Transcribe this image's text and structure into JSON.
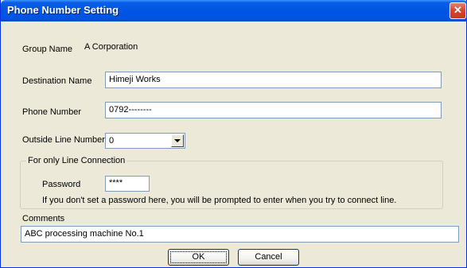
{
  "window": {
    "title": "Phone Number Setting",
    "close_glyph": "✕"
  },
  "group": {
    "label": "Group Name",
    "value": "A Corporation"
  },
  "destination": {
    "label": "Destination Name",
    "value": "Himeji Works"
  },
  "phone": {
    "label": "Phone Number",
    "value": "0792--------"
  },
  "outside_line": {
    "label": "Outside Line Number",
    "value": "0"
  },
  "line_connection": {
    "legend": "For only Line Connection",
    "password_label": "Password",
    "password_value": "****",
    "note": "If you don't set a password here, you will be prompted to enter when you try to connect line."
  },
  "comments": {
    "label": "Comments",
    "value": "ABC processing machine No.1"
  },
  "buttons": {
    "ok": "OK",
    "cancel": "Cancel"
  },
  "colors": {
    "title_bar": "#0054e3",
    "dialog_bg": "#ece9d8",
    "input_border": "#7f9db9"
  }
}
